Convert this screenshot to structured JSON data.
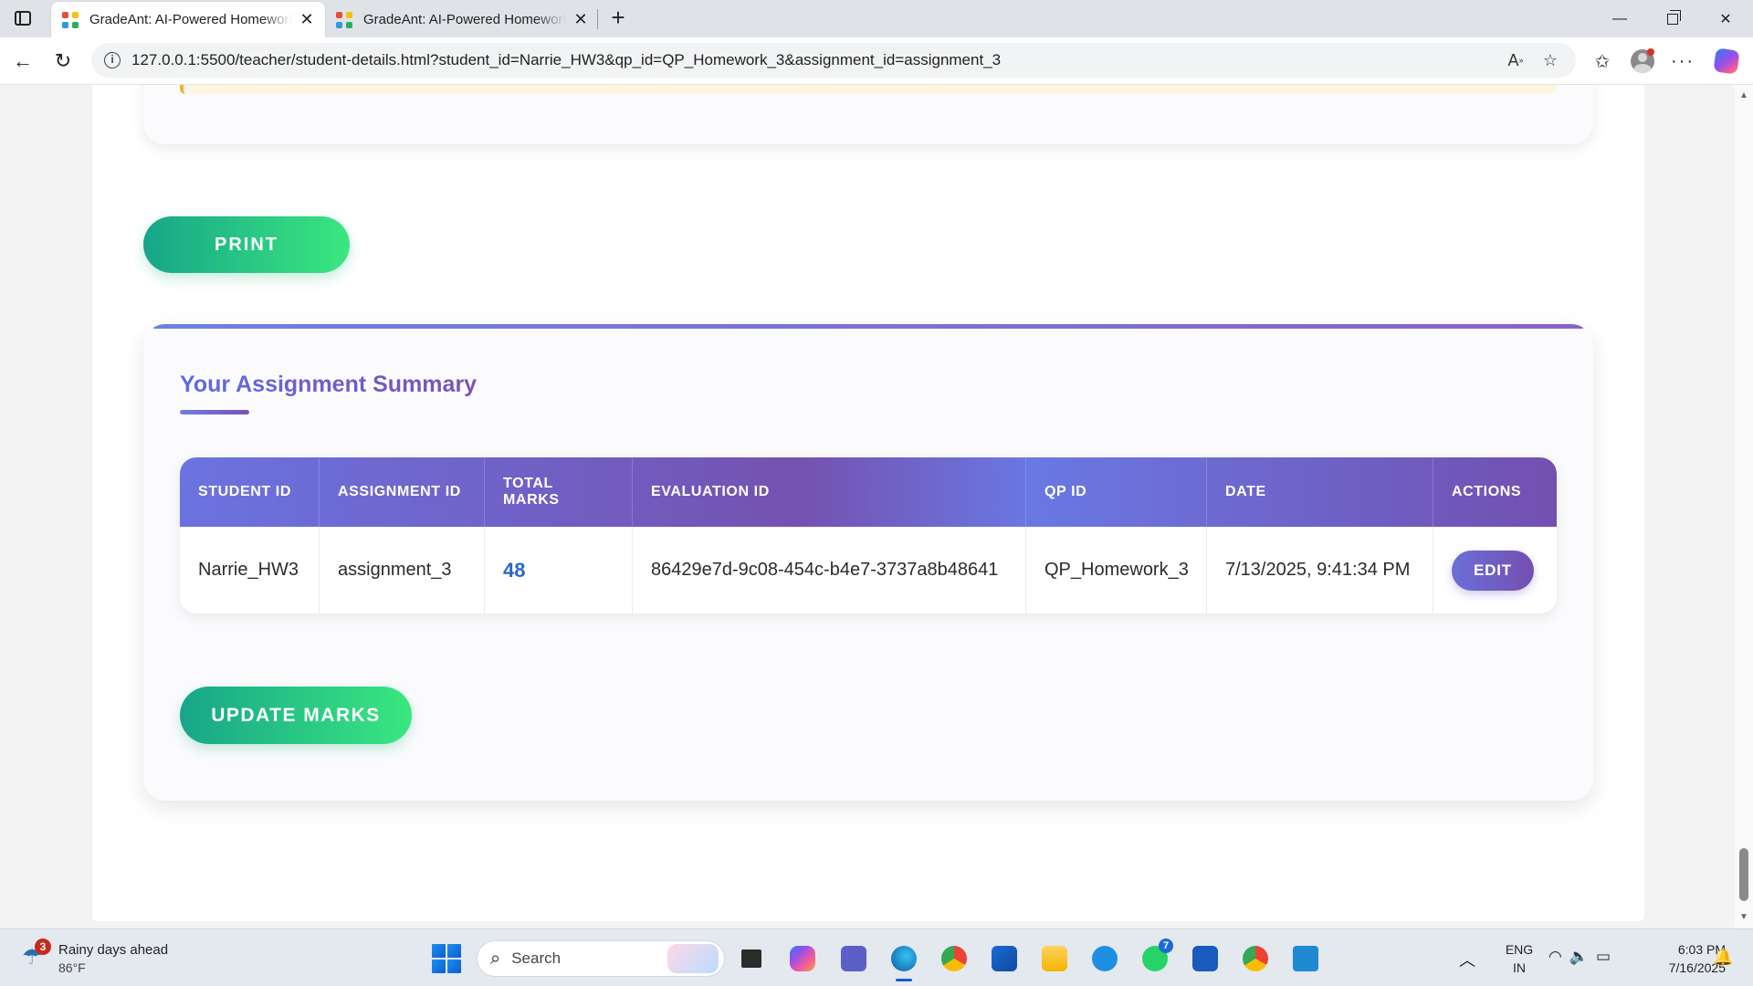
{
  "browser": {
    "tabs": [
      {
        "title": "GradeAnt: AI-Powered Homework",
        "active": true
      },
      {
        "title": "GradeAnt: AI-Powered Homework",
        "active": false
      }
    ],
    "url": "127.0.0.1:5500/teacher/student-details.html?student_id=Narrie_HW3&qp_id=QP_Homework_3&assignment_id=assignment_3"
  },
  "page": {
    "print_label": "PRINT",
    "summary": {
      "title": "Your Assignment Summary",
      "columns": [
        "STUDENT ID",
        "ASSIGNMENT ID",
        "TOTAL MARKS",
        "EVALUATION ID",
        "QP ID",
        "DATE",
        "ACTIONS"
      ],
      "row": {
        "student_id": "Narrie_HW3",
        "assignment_id": "assignment_3",
        "total_marks": "48",
        "evaluation_id": "86429e7d-9c08-454c-b4e7-3737a8b48641",
        "qp_id": "QP_Homework_3",
        "date": "7/13/2025, 9:41:34 PM",
        "action_label": "EDIT"
      },
      "update_label": "UPDATE MARKS"
    }
  },
  "taskbar": {
    "weather_title": "Rainy days ahead",
    "weather_temp": "86°F",
    "weather_badge": "3",
    "search_placeholder": "Search",
    "teams_badge": "7",
    "lang_line1": "ENG",
    "lang_line2": "IN",
    "time": "6:03 PM",
    "date": "7/16/2025"
  },
  "colors": {
    "accent_green": "#17a589",
    "accent_purple": "#744fb0",
    "marks_blue": "#2a66c8"
  }
}
